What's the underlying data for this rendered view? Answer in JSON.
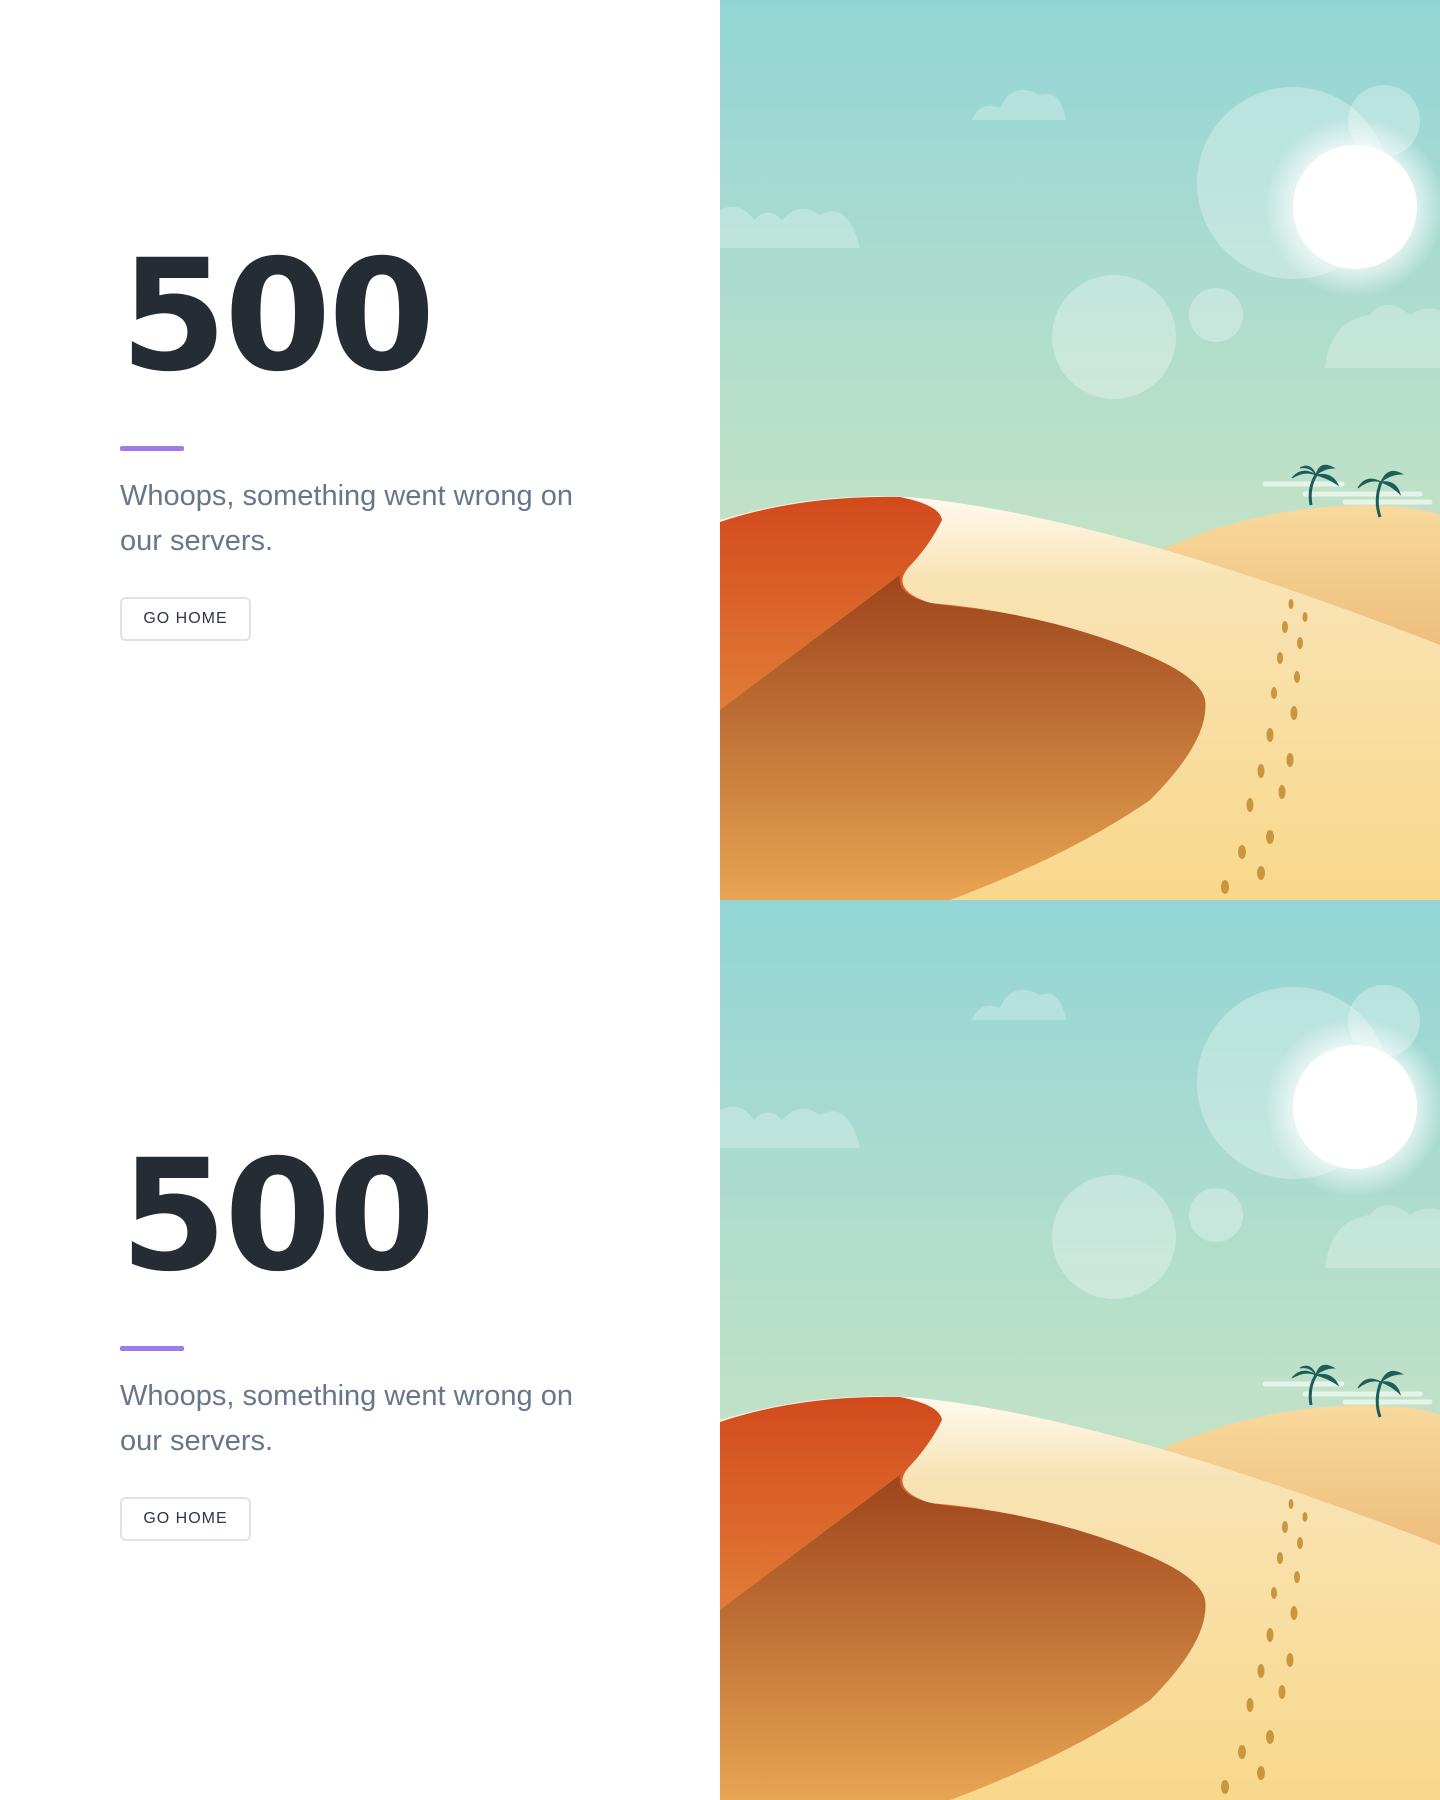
{
  "error": {
    "code": "500",
    "message": "Whoops, something went wrong on our servers.",
    "button_label": "GO HOME"
  },
  "colors": {
    "accent": "#9f7aea",
    "heading": "#252c33",
    "message": "#66778a",
    "sky_top": "#93d5d6",
    "sky_bottom": "#cfe6c4",
    "dune_dark": "#d4511f",
    "sand": "#f8d88e"
  },
  "illustration": {
    "icons": [
      "sun-icon",
      "cloud-icon",
      "palm-tree-icon",
      "footprints-icon"
    ]
  }
}
